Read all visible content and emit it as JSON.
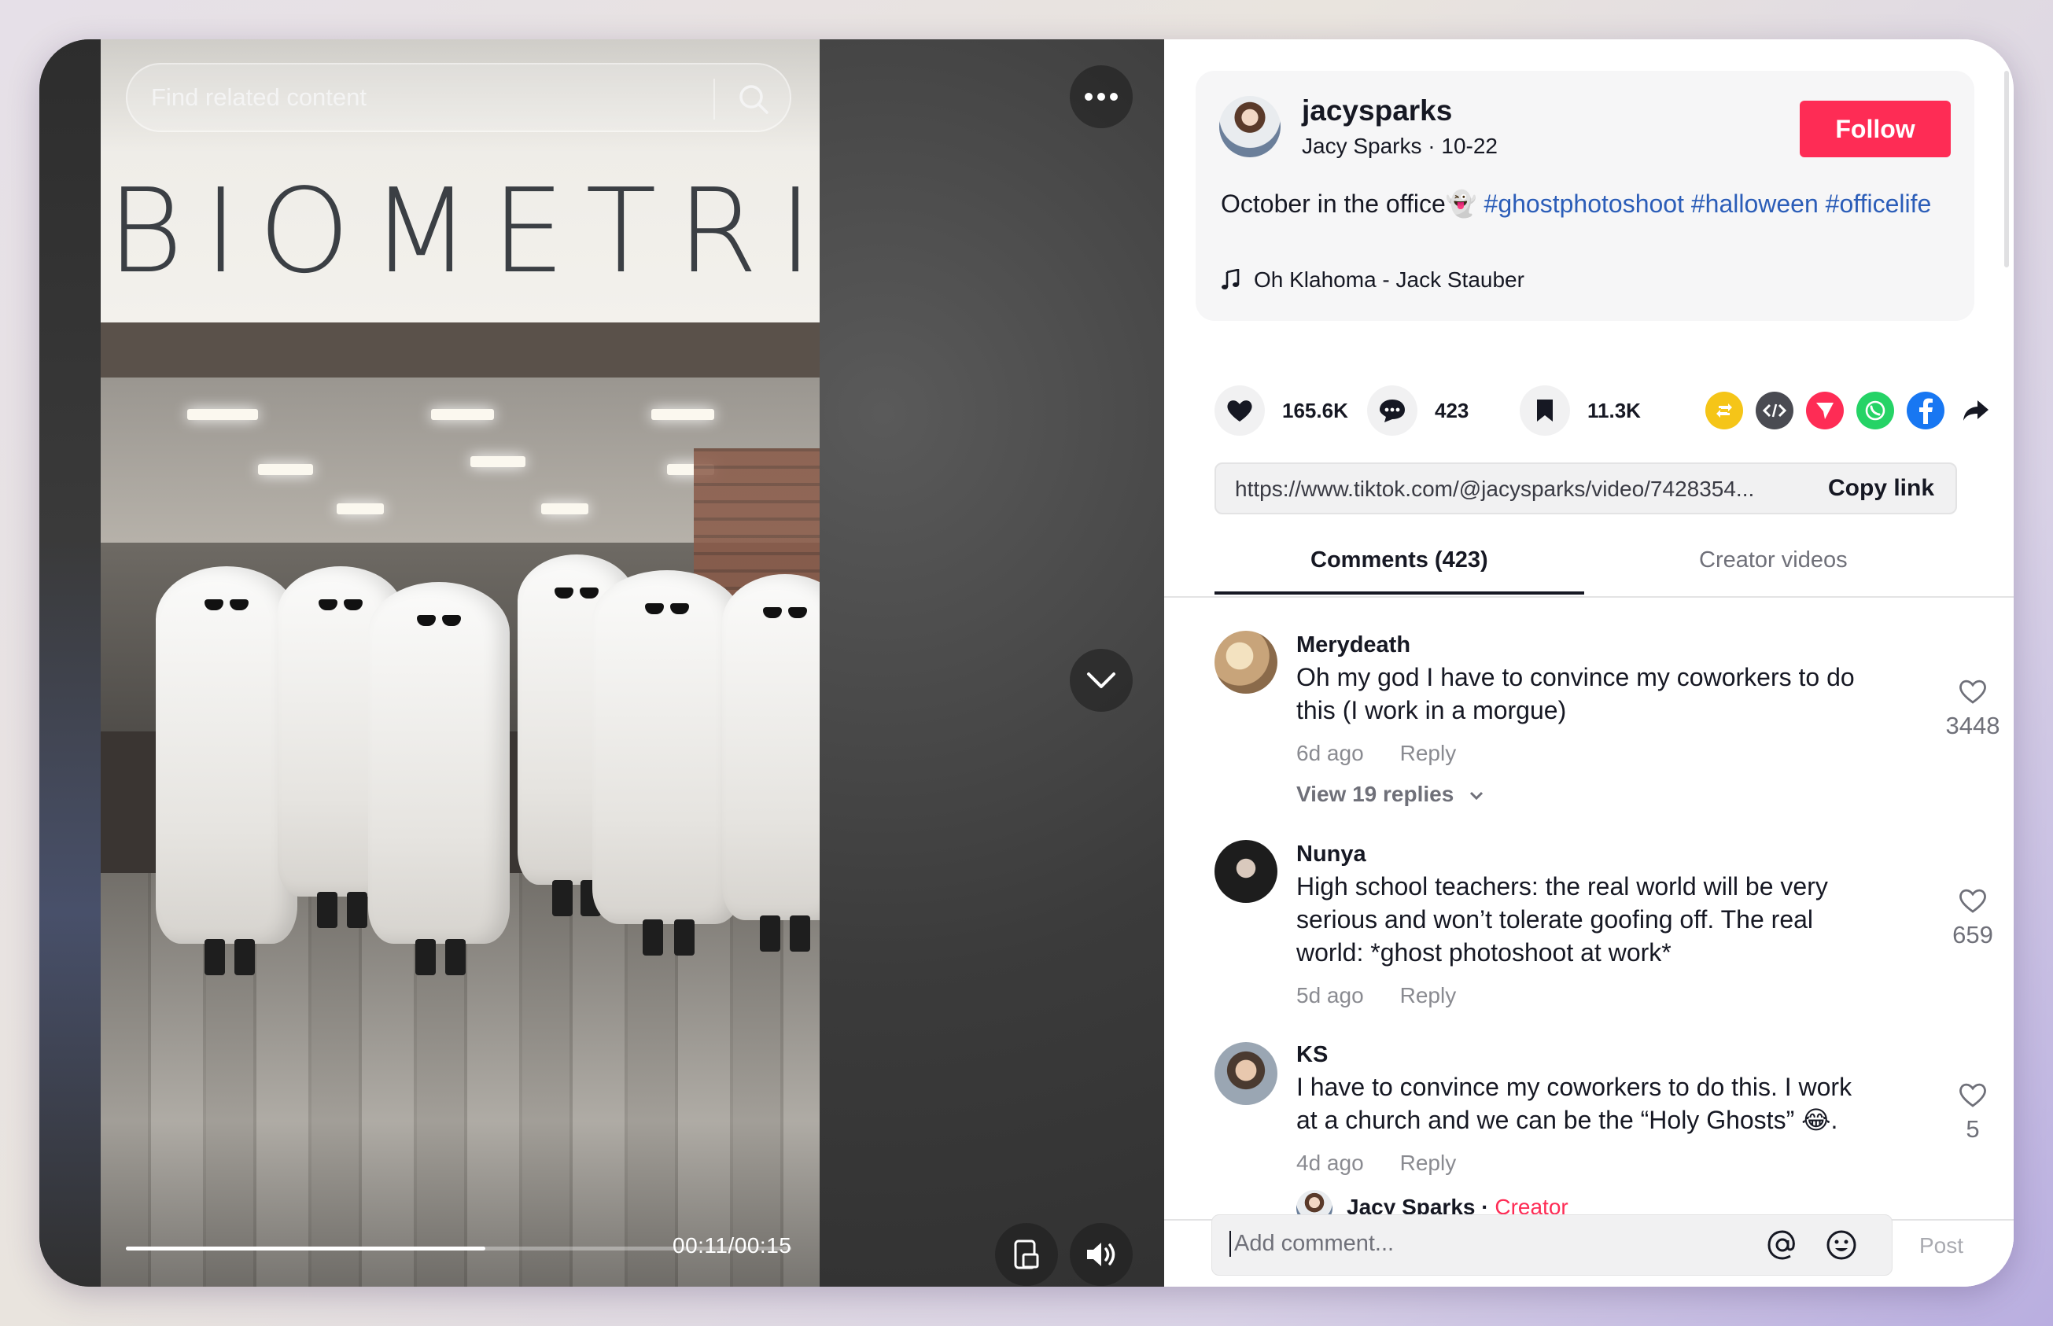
{
  "search": {
    "placeholder": "Find related content"
  },
  "player": {
    "timecode": "00:11/00:15",
    "progress": 0.73,
    "sign_text": "BIOMETRICS"
  },
  "author": {
    "username": "jacysparks",
    "meta": "Jacy Sparks · 10-22",
    "follow_label": "Follow"
  },
  "post": {
    "caption_text": "October in the office👻",
    "hashtags": [
      "#ghostphotoshoot",
      "#halloween",
      "#officelife"
    ],
    "music": "Oh Klahoma - Jack Stauber"
  },
  "stats": {
    "likes": "165.6K",
    "comments": "423",
    "saves": "11.3K"
  },
  "share_icons": [
    "repost-icon",
    "embed-icon",
    "send-icon",
    "whatsapp-icon",
    "facebook-icon",
    "share-arrow-icon"
  ],
  "link": {
    "url": "https://www.tiktok.com/@jacysparks/video/7428354...",
    "copy_label": "Copy link"
  },
  "tabs": [
    {
      "label": "Comments (423)",
      "active": true
    },
    {
      "label": "Creator videos",
      "active": false
    }
  ],
  "comments": [
    {
      "name": "Merydeath",
      "text": "Oh my god I have to convince my coworkers to do this (I work in a morgue)",
      "time": "6d ago",
      "reply_label": "Reply",
      "likes": "3448",
      "view_replies": "View 19 replies"
    },
    {
      "name": "Nunya",
      "text": "High school teachers: the real world will be very serious and won’t tolerate goofing off. The real world: *ghost photoshoot at work*",
      "time": "5d ago",
      "reply_label": "Reply",
      "likes": "659"
    },
    {
      "name": "KS",
      "text": "I have to convince my coworkers to do this. I work at a church and we can be the “Holy Ghosts” 😂.",
      "time": "4d ago",
      "reply_label": "Reply",
      "likes": "5",
      "creator_reply": {
        "name": "Jacy Sparks",
        "sep": " · ",
        "badge": "Creator"
      }
    }
  ],
  "composer": {
    "placeholder": "Add comment...",
    "post_label": "Post"
  },
  "colors": {
    "accent": "#fe2c55",
    "hashtag": "#2b5db8"
  }
}
